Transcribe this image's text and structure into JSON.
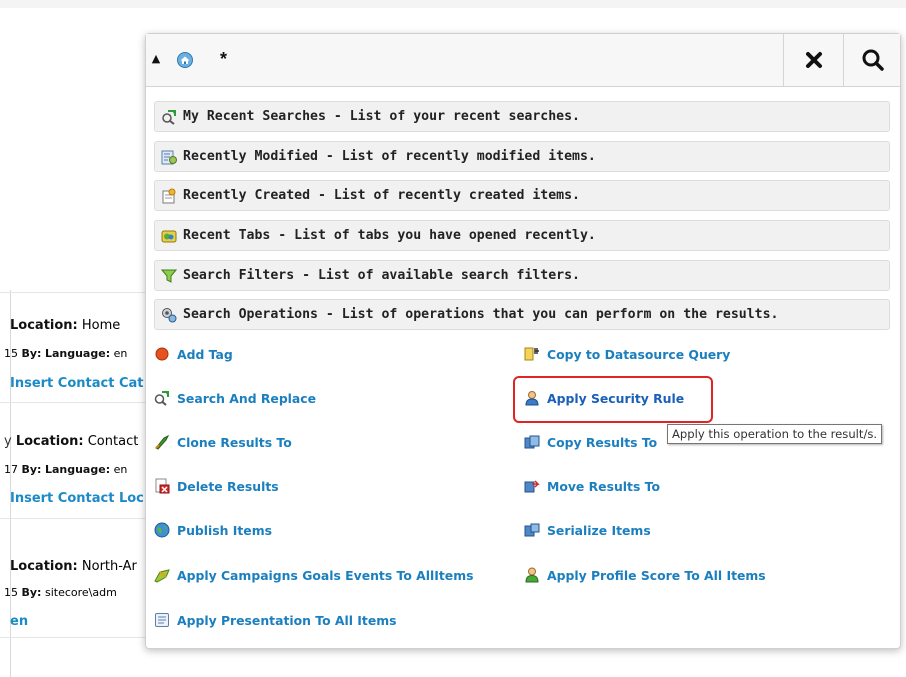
{
  "search": {
    "query": "*",
    "clear_label": "✖"
  },
  "sections": [
    {
      "icon": "recent-searches-icon",
      "label": "My Recent Searches - List of your recent searches."
    },
    {
      "icon": "recently-modified-icon",
      "label": "Recently Modified - List of recently modified items."
    },
    {
      "icon": "recently-created-icon",
      "label": "Recently Created - List of recently created items."
    },
    {
      "icon": "recent-tabs-icon",
      "label": "Recent Tabs - List of tabs you have opened recently."
    },
    {
      "icon": "search-filters-icon",
      "label": "Search Filters - List of available search filters."
    },
    {
      "icon": "search-operations-icon",
      "label": "Search Operations - List of operations that you can perform on the results."
    }
  ],
  "operations": {
    "left": [
      {
        "icon": "tag-icon",
        "label": "Add Tag"
      },
      {
        "icon": "search-replace-icon",
        "label": "Search And Replace"
      },
      {
        "icon": "clone-icon",
        "label": "Clone Results To"
      },
      {
        "icon": "delete-icon",
        "label": "Delete Results"
      },
      {
        "icon": "publish-globe-icon",
        "label": "Publish Items"
      },
      {
        "icon": "campaign-goals-icon",
        "label": "Apply Campaigns Goals Events To AllItems"
      },
      {
        "icon": "presentation-icon",
        "label": "Apply Presentation To All Items"
      }
    ],
    "right": [
      {
        "icon": "datasource-query-icon",
        "label": "Copy to Datasource Query"
      },
      {
        "icon": "security-user-icon",
        "label": "Apply Security Rule"
      },
      {
        "icon": "copy-results-icon",
        "label": "Copy Results To"
      },
      {
        "icon": "move-results-icon",
        "label": "Move Results To"
      },
      {
        "icon": "serialize-icon",
        "label": "Serialize Items"
      },
      {
        "icon": "profile-score-icon",
        "label": "Apply Profile Score To All Items"
      }
    ]
  },
  "tooltip": "Apply this operation to the result/s.",
  "background_results": [
    {
      "location_label": "Location:",
      "location": "Home",
      "meta_prefix": "15",
      "by_label": "By:",
      "by_value": "Language:",
      "meta_value": "en",
      "title": "Insert Contact Cat"
    },
    {
      "location_label": "Location:",
      "location": "Contact",
      "meta_prefix": "17",
      "by_label": "By:",
      "by_value": "Language:",
      "meta_value": "en",
      "title": "Insert Contact Loc"
    },
    {
      "location_label": "Location:",
      "location": "North-Ar",
      "meta_prefix": "15",
      "by_label": "By:",
      "by_value": "",
      "meta_value": "sitecore\\adm",
      "title": "en"
    }
  ],
  "colors": {
    "link": "#1b7fbf",
    "highlight": "#e02424"
  }
}
